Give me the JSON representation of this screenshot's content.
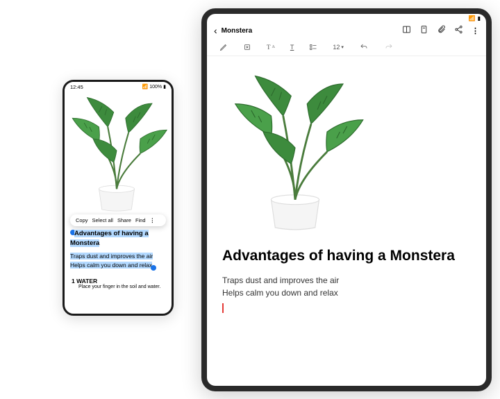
{
  "phone": {
    "status": {
      "time": "12:45",
      "battery": "100%",
      "signal": "📶"
    },
    "context_menu": {
      "copy": "Copy",
      "select_all": "Select all",
      "share": "Share",
      "find": "Find"
    },
    "text": {
      "title": "Advantages of having a Monstera",
      "line1": "Traps dust and improves the air",
      "line2": "Helps calm you down and relax"
    },
    "water": {
      "heading": "1  WATER",
      "body": "Place your finger in the soil and water."
    }
  },
  "tablet": {
    "title": "Monstera",
    "toolbar": {
      "font_size": "12"
    },
    "heading": "Advantages of having a Monstera",
    "body": {
      "line1": "Traps dust and improves the air",
      "line2": "Helps calm you down and relax"
    }
  }
}
